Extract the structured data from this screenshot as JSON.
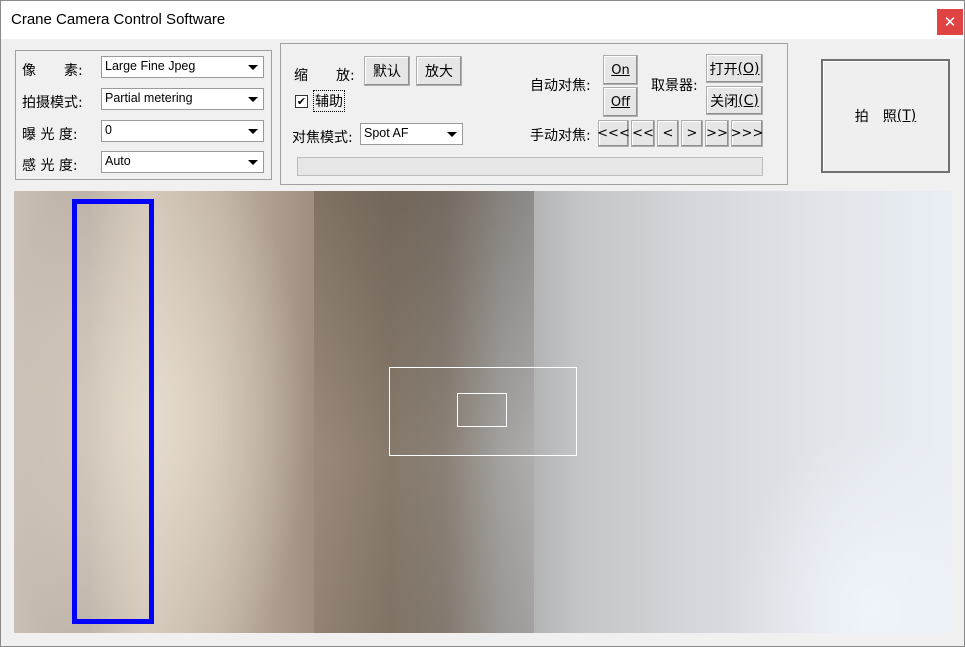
{
  "window": {
    "title": "Crane Camera Control Software",
    "close_symbol": "✕"
  },
  "left_panel": {
    "pixel_label": "像　　素:",
    "pixel_value": "Large Fine Jpeg",
    "mode_label": "拍摄模式:",
    "mode_value": "Partial metering",
    "exposure_label": "曝 光 度:",
    "exposure_value": "0",
    "iso_label": "感 光 度:",
    "iso_value": "Auto"
  },
  "middle_panel": {
    "zoom_label": "缩　　放:",
    "zoom_default_button": "默认",
    "zoom_in_button": "放大",
    "assist_label": "辅助",
    "assist_checked": true,
    "focus_mode_label": "对焦模式:",
    "focus_mode_value": "Spot AF",
    "autofocus_label": "自动对焦:",
    "af_on_button": "On",
    "af_off_button": "Off",
    "viewfinder_label": "取景器:",
    "viewfinder_open_button": "打开",
    "viewfinder_open_key": "(O)",
    "viewfinder_close_button": "关闭",
    "viewfinder_close_key": "(C)",
    "manual_focus_label": "手动对焦:",
    "manual_buttons": [
      "<<<",
      "<<",
      "<",
      ">",
      ">>",
      ">>>"
    ],
    "progress_fraction": 0
  },
  "capture": {
    "label": "拍　照",
    "shortcut": "(T)"
  },
  "colors": {
    "focus_frame": "#0000ff",
    "af_frame": "#ffffff",
    "close_button_bg": "#e04343"
  }
}
